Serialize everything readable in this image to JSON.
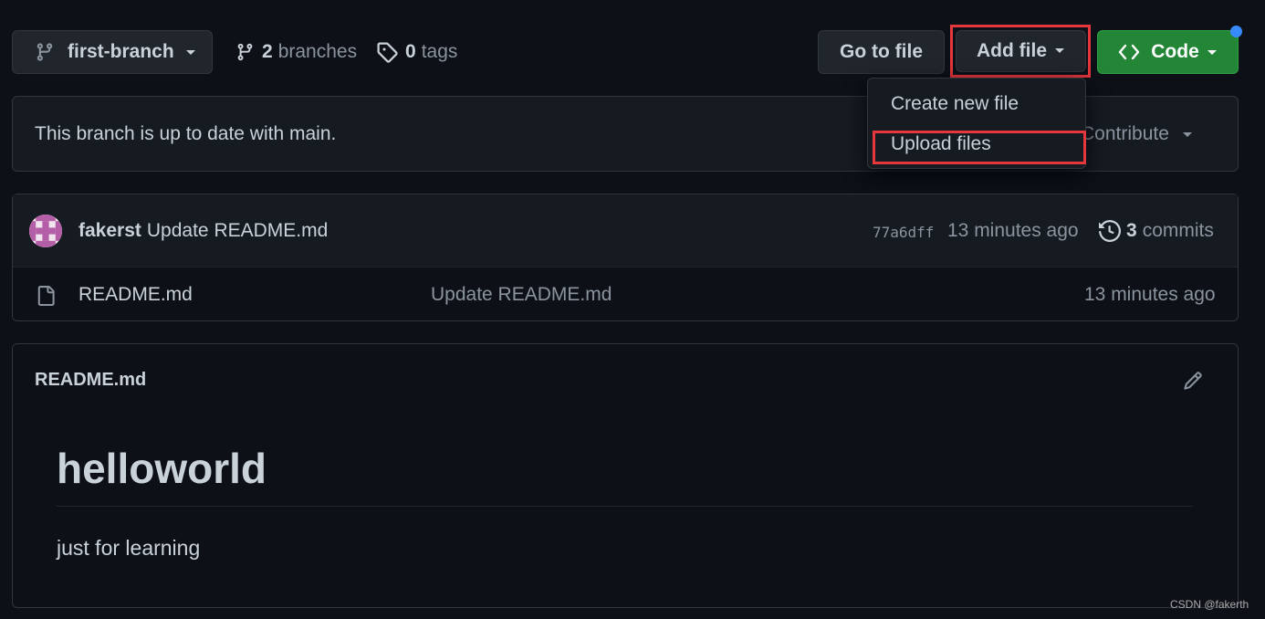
{
  "toolbar": {
    "branch_name": "first-branch",
    "branches_count": "2",
    "branches_label": "branches",
    "tags_count": "0",
    "tags_label": "tags",
    "go_to_file": "Go to file",
    "add_file": "Add file",
    "code": "Code"
  },
  "add_file_menu": {
    "items": [
      "Create new file",
      "Upload files"
    ]
  },
  "status": {
    "text": "This branch is up to date with main.",
    "contribute": "Contribute"
  },
  "latest_commit": {
    "author": "fakerst",
    "message": "Update README.md",
    "sha": "77a6dff",
    "time": "13 minutes ago",
    "commits_count": "3",
    "commits_label": "commits"
  },
  "files": [
    {
      "name": "README.md",
      "commit_message": "Update README.md",
      "time": "13 minutes ago"
    }
  ],
  "readme": {
    "title": "README.md",
    "heading": "helloworld",
    "paragraph": "just for learning"
  },
  "watermark": "CSDN @fakerth",
  "colors": {
    "background": "#0d1117",
    "primary_button": "#238636",
    "highlight": "#e5373c",
    "notification_dot": "#388bfd"
  }
}
